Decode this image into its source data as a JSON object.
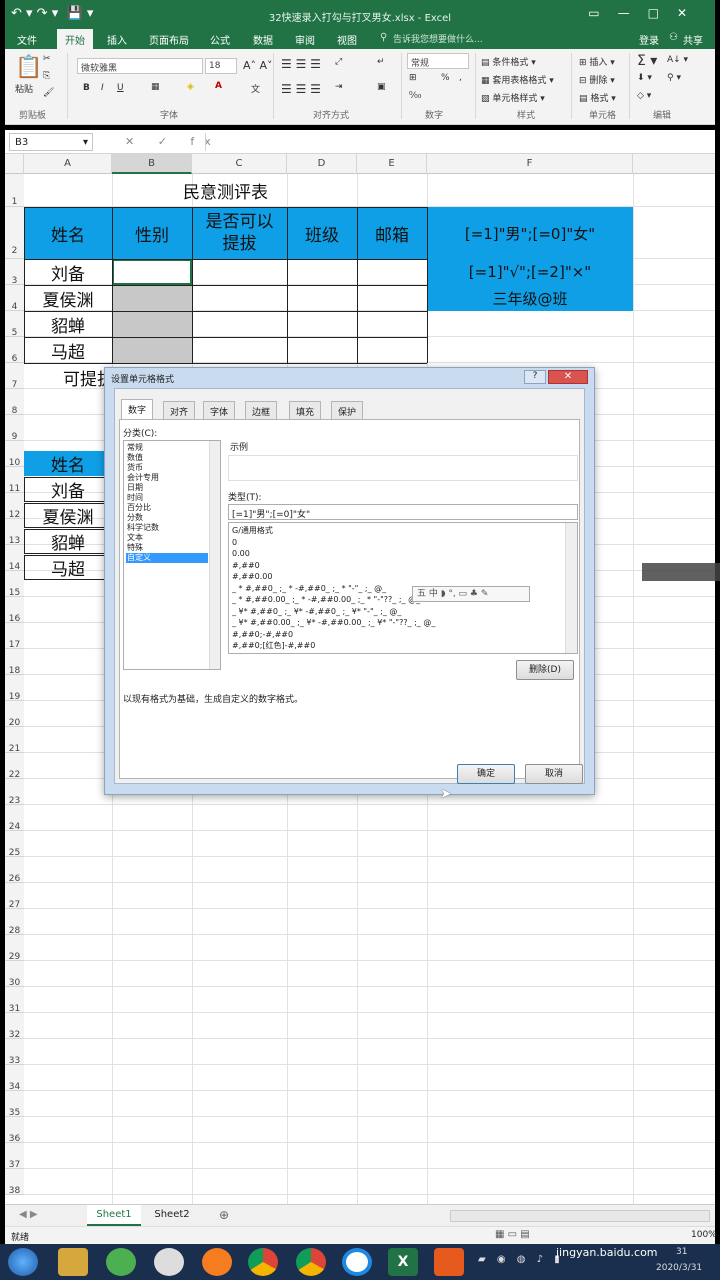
{
  "window": {
    "title": "32快速录入打勾与打叉男女.xlsx - Excel"
  },
  "menu_tabs": [
    "文件",
    "开始",
    "插入",
    "页面布局",
    "公式",
    "数据",
    "审阅",
    "视图"
  ],
  "tell_me": "告诉我您想要做什么...",
  "login": "登录",
  "share": "共享",
  "ribbon": {
    "paste": "粘贴",
    "clipboard": "剪贴板",
    "font_group": "字体",
    "align_group": "对齐方式",
    "number_group": "数字",
    "styles_group": "样式",
    "cells_group": "单元格",
    "editing_group": "编辑",
    "font_name": "微软雅黑",
    "font_size": "18",
    "number_format": "常规",
    "cond_format": "条件格式",
    "table_format": "套用表格格式",
    "cell_style": "单元格样式",
    "insert": "插入",
    "delete": "删除",
    "format": "格式",
    "bold": "B",
    "italic": "I",
    "underline": "U",
    "pct": "%",
    "comma": ","
  },
  "name_box": "B3",
  "columns": [
    "A",
    "B",
    "C",
    "D",
    "E",
    "F"
  ],
  "rows": [
    "1",
    "2",
    "3",
    "4",
    "5",
    "6",
    "7",
    "8",
    "9",
    "10",
    "11",
    "12",
    "13",
    "14",
    "15",
    "16",
    "17",
    "18",
    "19",
    "20",
    "21",
    "22",
    "23",
    "24",
    "25",
    "26",
    "27",
    "28",
    "29",
    "30",
    "31",
    "32",
    "33",
    "34",
    "35",
    "36",
    "37",
    "38"
  ],
  "table": {
    "title": "民意测评表",
    "headers": [
      "姓名",
      "性别",
      "是否可以提拔",
      "班级",
      "邮箱"
    ],
    "names": [
      "刘备",
      "夏侯渊",
      "貂蝉",
      "马超"
    ],
    "notes": [
      "[=1]\"男\";[=0]\"女\"",
      "[=1]\"√\";[=2]\"×\"",
      "三年级@班"
    ],
    "row7": "可提拔",
    "list_header": "姓名",
    "list_names": [
      "刘备",
      "夏侯渊",
      "貂蝉",
      "马超"
    ]
  },
  "dialog": {
    "title": "设置单元格格式",
    "tabs": [
      "数字",
      "对齐",
      "字体",
      "边框",
      "填充",
      "保护"
    ],
    "category_label": "分类(C):",
    "categories": [
      "常规",
      "数值",
      "货币",
      "会计专用",
      "日期",
      "时间",
      "百分比",
      "分数",
      "科学记数",
      "文本",
      "特殊",
      "自定义"
    ],
    "selected_category": "自定义",
    "sample_label": "示例",
    "type_label": "类型(T):",
    "type_value": "[=1]\"男\";[=0]\"女\"",
    "formats": [
      "G/通用格式",
      "0",
      "0.00",
      "#,##0",
      "#,##0.00",
      "_ * #,##0_ ;_ * -#,##0_ ;_ * \"-\"_ ;_ @_",
      "_ * #,##0.00_ ;_ * -#,##0.00_ ;_ * \"-\"??_ ;_ @_",
      "_ ¥* #,##0_ ;_ ¥* -#,##0_ ;_ ¥* \"-\"_ ;_ @_",
      "_ ¥* #,##0.00_ ;_ ¥* -#,##0.00_ ;_ ¥* \"-\"??_ ;_ @_",
      "#,##0;-#,##0",
      "#,##0;[红色]-#,##0"
    ],
    "delete_btn": "删除(D)",
    "description": "以现有格式为基础，生成自定义的数字格式。",
    "ok": "确定",
    "cancel": "取消"
  },
  "sheet_tabs": [
    "Sheet1",
    "Sheet2"
  ],
  "status": {
    "ready": "就绪",
    "zoom": "100%"
  },
  "taskbar": {
    "clock_time": "31",
    "date": "2020/3/31",
    "watermark": "jingyan.baidu.com"
  },
  "colors": {
    "excel_green": "#217346",
    "header_blue": "#0f9fe6",
    "gray_cell": "#c8c8c8"
  }
}
